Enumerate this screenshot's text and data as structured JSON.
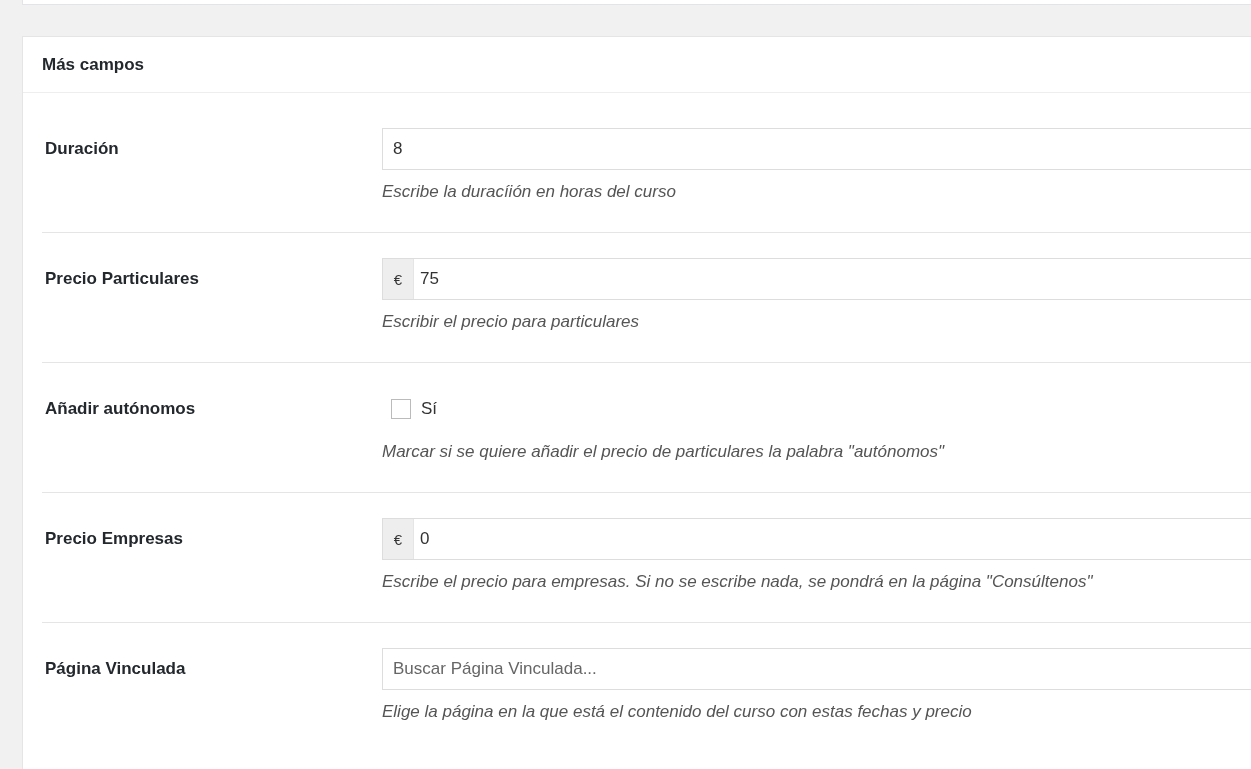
{
  "panel": {
    "title": "Más campos"
  },
  "fields": [
    {
      "kind": "text",
      "label": "Duración",
      "value": "8",
      "description": "Escribe la duracíión en horas del curso"
    },
    {
      "kind": "prepend",
      "label": "Precio Particulares",
      "prefix": "€",
      "value": "75",
      "description": "Escribir el precio para particulares"
    },
    {
      "kind": "checkbox",
      "label": "Añadir autónomos",
      "option": "Sí",
      "checked": false,
      "description": "Marcar si se quiere añadir el precio de particulares la palabra \"autónomos\""
    },
    {
      "kind": "prepend",
      "label": "Precio Empresas",
      "prefix": "€",
      "value": "0",
      "description": "Escribe el precio para empresas. Si no se escribe nada, se pondrá en la página \"Consúltenos\""
    },
    {
      "kind": "search",
      "label": "Página Vinculada",
      "placeholder": "Buscar Página Vinculada...",
      "description": "Elige la página en la que está el contenido del curso con estas fechas y precio"
    }
  ]
}
